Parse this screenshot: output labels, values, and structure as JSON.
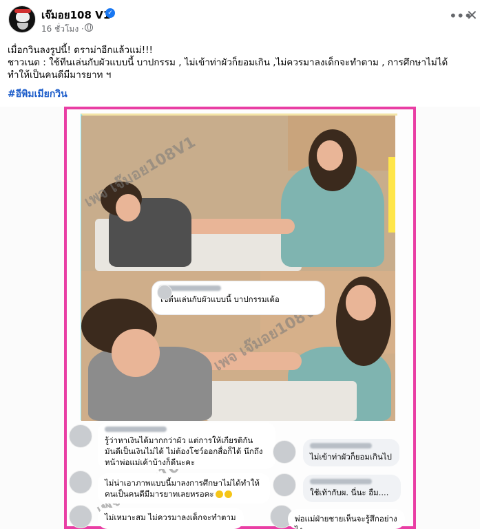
{
  "post": {
    "page_name": "เจ๊มอย108 V1",
    "time": "16 ชั่วโมง ·",
    "lines": [
      "เมื่อกวินลงรูปนี้! ดราม่าอีกแล้วแม่!!!",
      "ชาวเนต : ใช้ทีนเล่นกับผัวแบบนี้ บาปกรรม , ไม่เข้าท่าผัวก็ยอมเกิน ,ไม่ควรมาลงเด็กจะทำตาม , การศึกษาไม่ได้",
      "ทำให้เป็นคนดีมีมารยาท ฯ"
    ],
    "hashtag": "#อีพิมเมียกวิน"
  },
  "image": {
    "watermark": "เพจ เจ๊มอย108V1",
    "comments": [
      {
        "text": "ใช้ตีนเล่นกับผัวแบบนี้ บาปกรรมเด้อ"
      },
      {
        "text": "รู้ว่าหาเงินได้มากกว่าผัว แต่การให้เกียรติกัน มันดีเป็นเงินไม่ได้ ไม่ต้องโชว์ออกสื่อก็ได้ นึกถึงหน้าพ่อแม่เค้าบ้างก็ดีนะคะ"
      },
      {
        "text": "ไม่เข้าท่าผัวก็ยอมเกินไป"
      },
      {
        "text": "ไม่น่าเอาภาพแบบนี้มาลงการศึกษาไม่ได้ทำให้คนเป็นคนดีมีมารยาทเลยหรอคะ"
      },
      {
        "text": "ใช้เท้ากับผ. นี่นะ อืม...."
      },
      {
        "text": "ไม่เหมาะสม ไม่ควรมาลงเด็กจะทำตาม"
      },
      {
        "text": "พ่อแม่ฝ่ายชายเห็นจะรู้สึกอย่างไง"
      }
    ]
  },
  "icons": {
    "verified": "verified-badge-icon",
    "globe": "globe-icon",
    "more": "more-options-icon",
    "close": "close-icon"
  },
  "colors": {
    "frame_border": "#e93ea4",
    "hashtag": "#1a5bc9",
    "verified": "#1877f2"
  }
}
